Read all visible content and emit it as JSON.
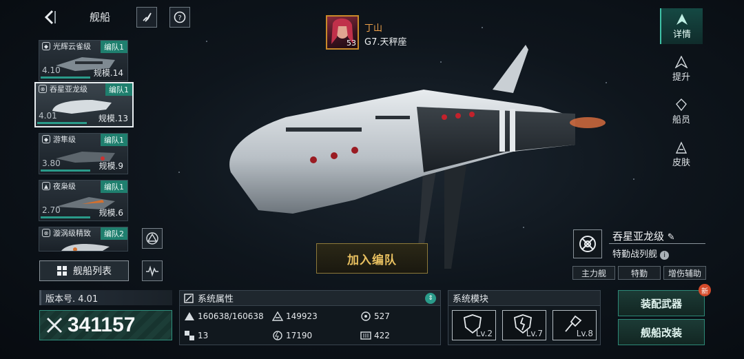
{
  "header": {
    "title": "舰船"
  },
  "ship_list": [
    {
      "class_name": "光辉云雀级",
      "fleet": "编队1",
      "version": "4.10",
      "scale": "规模.14"
    },
    {
      "class_name": "吞星亚龙级",
      "fleet": "编队1",
      "version": "4.01",
      "scale": "规模.13"
    },
    {
      "class_name": "游隼级",
      "fleet": "编队1",
      "version": "3.80",
      "scale": "规模.9"
    },
    {
      "class_name": "夜枭级",
      "fleet": "编队1",
      "version": "2.70",
      "scale": "规模.6"
    },
    {
      "class_name": "漩涡级精致",
      "fleet": "编队2",
      "version": "",
      "scale": ""
    }
  ],
  "ship_list_button": "舰船列表",
  "commander": {
    "name": "丁山",
    "system": "G7.天秤座",
    "level": "53"
  },
  "right_nav": [
    {
      "label": "详情"
    },
    {
      "label": "提升"
    },
    {
      "label": "船员"
    },
    {
      "label": "皮肤"
    }
  ],
  "ship_info": {
    "name": "吞星亚龙级",
    "type": "特勤战列舰",
    "tags": [
      "主力舰",
      "特勤",
      "增伤辅助"
    ]
  },
  "join_fleet_button": "加入编队",
  "version_label": "版本号. 4.01",
  "power": "341157",
  "attributes": {
    "title": "系统属性",
    "values": [
      "160638/160638",
      "149923",
      "527",
      "13",
      "17190",
      "422"
    ]
  },
  "modules": {
    "title": "系统模块",
    "slots": [
      {
        "level": "Lv.2"
      },
      {
        "level": "Lv.7"
      },
      {
        "level": "Lv.8"
      }
    ]
  },
  "actions": {
    "equip": "装配武器",
    "modify": "舰船改装",
    "new_badge": "新"
  },
  "colors": {
    "accent": "#2a9b8a",
    "gold": "#e8c060",
    "commander_name": "#f0a24a"
  }
}
